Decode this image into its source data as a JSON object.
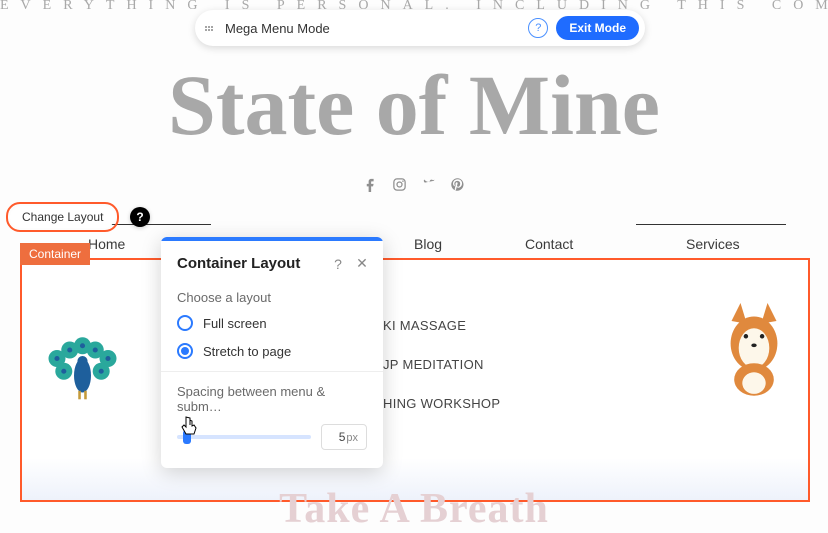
{
  "tagline": "EVERYTHING IS PERSONAL. INCLUDING THIS COMPANY.",
  "mode_bar": {
    "label": "Mega Menu Mode",
    "help_symbol": "?",
    "exit_label": "Exit Mode"
  },
  "site_title": "State of Mine",
  "social": {
    "facebook": "facebook-icon",
    "instagram": "instagram-icon",
    "twitter": "twitter-icon",
    "pinterest": "pinterest-icon"
  },
  "change_layout_button": "Change Layout",
  "help_dark_symbol": "?",
  "nav": {
    "home": "Home",
    "blog": "Blog",
    "contact": "Contact",
    "services": "Services"
  },
  "container_label": "Container",
  "submenu_items": [
    "KI MASSAGE",
    "JP MEDITATION",
    "HING WORKSHOP"
  ],
  "popover": {
    "title": "Container Layout",
    "help_symbol": "?",
    "close_symbol": "✕",
    "section_label": "Choose a layout",
    "options": {
      "full_screen": "Full screen",
      "stretch": "Stretch to page"
    },
    "selected": "stretch",
    "spacing_label": "Spacing between menu & subm…",
    "spacing_value": "5",
    "spacing_unit": "px"
  },
  "bottom_title": "Take A Breath"
}
